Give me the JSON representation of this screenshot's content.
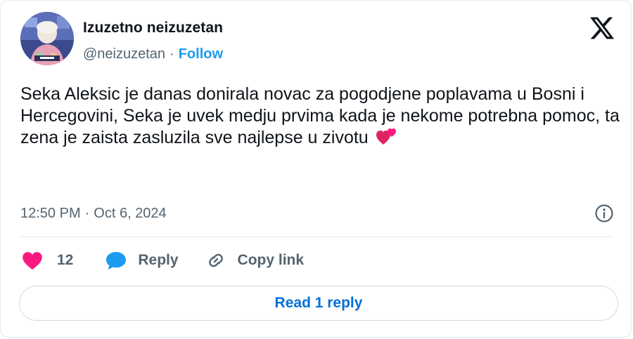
{
  "author": {
    "display_name": "Izuzetno neizuzetan",
    "handle": "@neizuzetan",
    "separator": "·",
    "follow_label": "Follow"
  },
  "tweet": {
    "text": "Seka Aleksic je danas donirala novac za pogodjene poplavama u Bosni i Hercegovini, Seka je uvek medju prvima kada je nekome potrebna pomoc, ta zena je zaista zasluzila sve najlepse u zivotu",
    "emoji": "two-hearts-icon",
    "time": "12:50 PM",
    "separator": "·",
    "date": "Oct 6, 2024"
  },
  "actions": {
    "like_count": "12",
    "reply_label": "Reply",
    "copy_link_label": "Copy link"
  },
  "read_replies_label": "Read 1 reply",
  "colors": {
    "accent": "#1d9bf0",
    "link_dark": "#006fd6",
    "heart": "#f91880",
    "muted": "#536471",
    "text": "#0f1419",
    "border": "#cfd9de"
  },
  "icons": {
    "logo": "x-logo-icon",
    "info": "info-icon",
    "like": "heart-icon",
    "reply": "speech-bubble-icon",
    "copy": "link-icon"
  }
}
